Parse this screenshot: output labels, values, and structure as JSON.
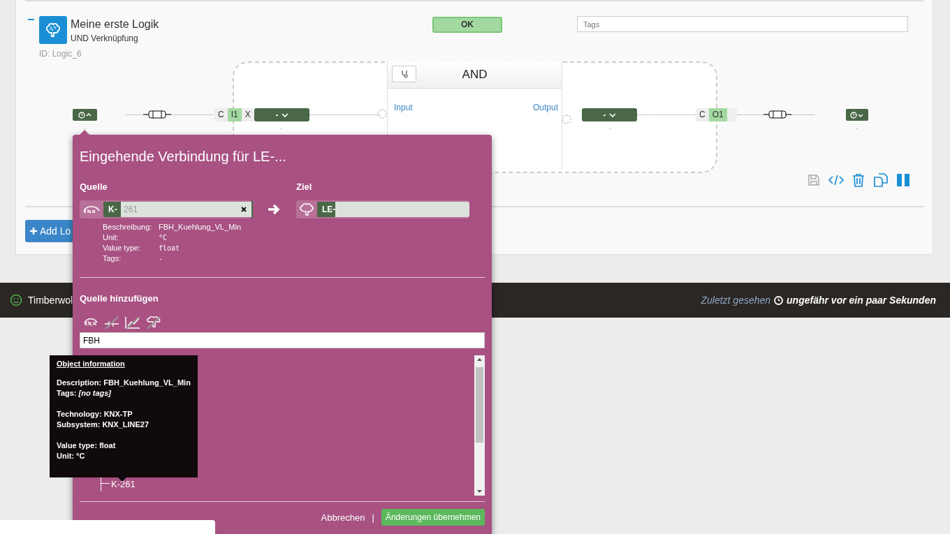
{
  "logic": {
    "collapse": "−",
    "title": "Meine erste Logik",
    "subtitle": "UND Verknüpfung",
    "id": "ID: Logic_6",
    "status": "OK",
    "tags_placeholder": "Tags"
  },
  "diagram": {
    "endpoints": [
      {
        "expanded": true,
        "value": "-"
      },
      {
        "expanded": false,
        "value": "-"
      }
    ],
    "input_port": {
      "chips": [
        {
          "text": "C",
          "kind": "plain"
        },
        {
          "text": "I1",
          "kind": "name"
        },
        {
          "text": "X",
          "kind": "plain"
        }
      ],
      "dropdown": "-",
      "value": "-"
    },
    "block": {
      "name": "AND",
      "input": "Input",
      "output": "Output"
    },
    "output_port": {
      "chips": [
        {
          "text": "C",
          "kind": "plain"
        },
        {
          "text": "O1",
          "kind": "name"
        }
      ],
      "dropdown": "-",
      "value": "-"
    }
  },
  "add_button": "Add Lo",
  "status_bar": {
    "name": "Timberwol",
    "seen_label": "Zuletzt gesehen",
    "seen_value": "ungefähr vor ein paar Sekunden"
  },
  "dialog": {
    "title": "Eingehende Verbindung für LE-...",
    "source_label": "Quelle",
    "target_label": "Ziel",
    "source": {
      "tag": "K-",
      "placeholder": "261"
    },
    "target": {
      "tag": "LE-"
    },
    "details": [
      {
        "label": "Beschreibung:",
        "value": "FBH_Kuehlung_VL_Min",
        "kind": "text"
      },
      {
        "label": "Unit:",
        "value": "°C",
        "kind": "code"
      },
      {
        "label": "Value type:",
        "value": "float",
        "kind": "code"
      },
      {
        "label": "Tags:",
        "value": "-",
        "kind": "code"
      }
    ],
    "add_label": "Quelle hinzufügen",
    "filters": [
      {
        "kind": "knx",
        "enabled": true
      },
      {
        "kind": "line",
        "enabled": false
      },
      {
        "kind": "chart",
        "enabled": false
      },
      {
        "kind": "brain",
        "enabled": false
      }
    ],
    "search": "FBH",
    "tree": [
      {
        "label": "K-261"
      }
    ],
    "cancel": "Abbrechen",
    "separator": "|",
    "apply": "Änderungen übernehmen"
  },
  "tooltip": {
    "title": "Object information",
    "groups": [
      [
        "Description: FBH_Kuehlung_VL_Min",
        "Tags: *[no tags]*"
      ],
      [
        "Technology: KNX-TP",
        "Subsystem: KNX_LINE27"
      ],
      [
        "Value type: float",
        "Unit: °C"
      ]
    ]
  }
}
